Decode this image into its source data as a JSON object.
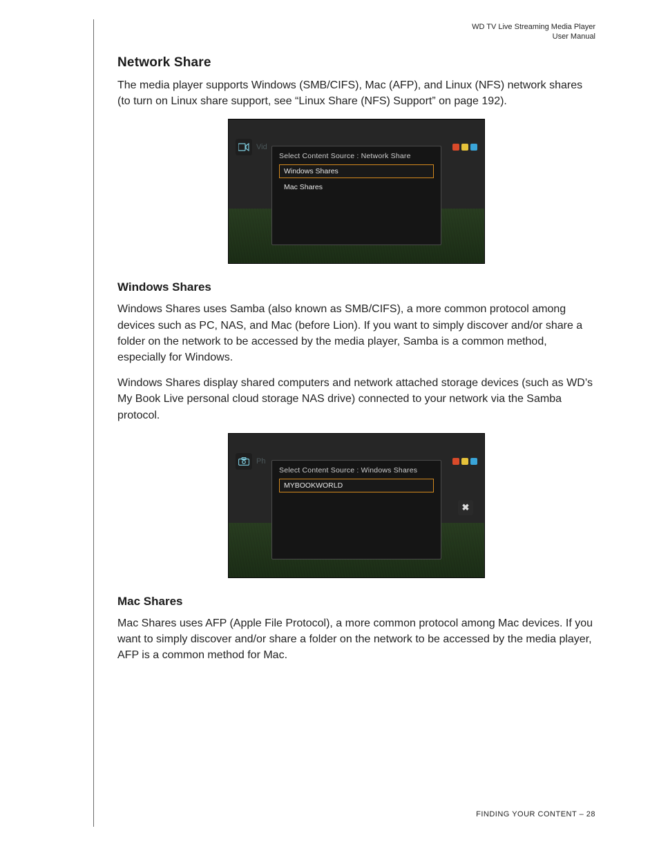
{
  "header": {
    "line1": "WD TV Live Streaming Media Player",
    "line2": "User Manual"
  },
  "sections": {
    "network_share": {
      "title": "Network Share",
      "para1": "The media player supports Windows (SMB/CIFS), Mac (AFP), and Linux (NFS) network shares (to turn on Linux share support, see “Linux Share (NFS) Support” on page 192)."
    },
    "windows_shares": {
      "title": "Windows Shares",
      "para1": "Windows Shares uses Samba (also known as SMB/CIFS), a more common protocol among devices such as PC, NAS, and Mac (before Lion). If you want to simply discover and/or share a folder on the network to be accessed by the media player, Samba is a common method, especially for Windows.",
      "para2": "Windows Shares display shared computers and network attached storage devices (such as WD’s My Book Live personal cloud storage NAS drive) connected to your network via the Samba protocol."
    },
    "mac_shares": {
      "title": "Mac Shares",
      "para1": "Mac Shares uses AFP (Apple File Protocol), a more common protocol among Mac devices. If you want to simply discover and/or share a folder on the network to be accessed by the media player, AFP is a common method for Mac."
    }
  },
  "figure1": {
    "side_icon_label": "Vid",
    "dialog_title": "Select Content Source : Network Share",
    "items": [
      "Windows Shares",
      "Mac Shares"
    ],
    "selected_index": 0,
    "dot_colors": [
      "#d94a2a",
      "#e6c23a",
      "#3aa5d9"
    ]
  },
  "figure2": {
    "side_icon_label": "Ph",
    "dialog_title": "Select Content Source : Windows Shares",
    "items": [
      "MYBOOKWORLD"
    ],
    "selected_index": 0,
    "close_glyph": "✖",
    "dot_colors": [
      "#d94a2a",
      "#e6c23a",
      "#3aa5d9"
    ]
  },
  "footer": {
    "section": "FINDING YOUR CONTENT",
    "separator": " – ",
    "page": "28"
  }
}
